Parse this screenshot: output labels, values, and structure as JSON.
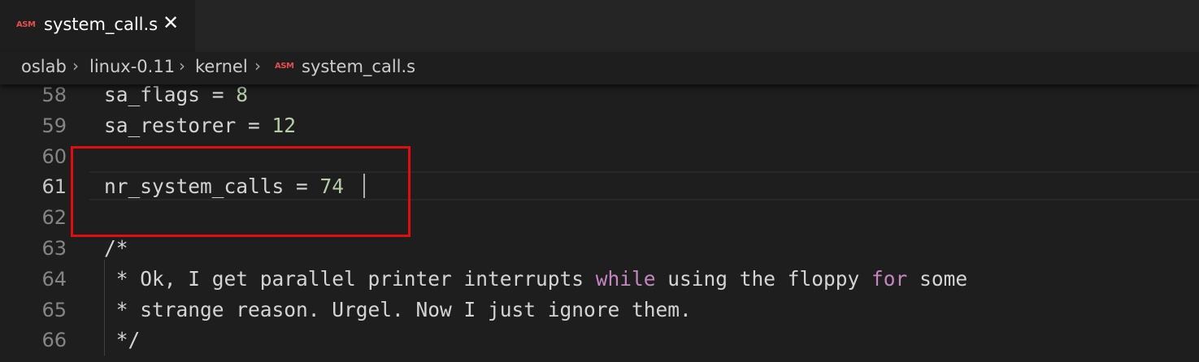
{
  "tab": {
    "icon": "ASM",
    "filename": "system_call.s",
    "close_symbol": "✕"
  },
  "breadcrumb": {
    "items": [
      "oslab",
      "linux-0.11",
      "kernel"
    ],
    "file_icon": "ASM",
    "file": "system_call.s"
  },
  "editor": {
    "lines": [
      {
        "num": "58",
        "text": "sa_flags = 8"
      },
      {
        "num": "59",
        "text": "sa_restorer = 12"
      },
      {
        "num": "60",
        "text": ""
      },
      {
        "num": "61",
        "text": "nr_system_calls = 74"
      },
      {
        "num": "62",
        "text": ""
      },
      {
        "num": "63",
        "text": "/*"
      },
      {
        "num": "64",
        "text": " * Ok, I get parallel printer interrupts while using the floppy for some"
      },
      {
        "num": "65",
        "text": " * strange reason. Urgel. Now I just ignore them."
      },
      {
        "num": "66",
        "text": " */"
      }
    ],
    "current_line": "61"
  },
  "colors": {
    "background": "#1e1e1e",
    "number_literal": "#b5cea8",
    "keyword": "#c586c0",
    "annotation_box": "#e30d0d"
  },
  "icons": {
    "tab_file_icon": "asm-file-icon",
    "close": "close-icon",
    "breadcrumb_separator": "chevron-right-icon"
  }
}
